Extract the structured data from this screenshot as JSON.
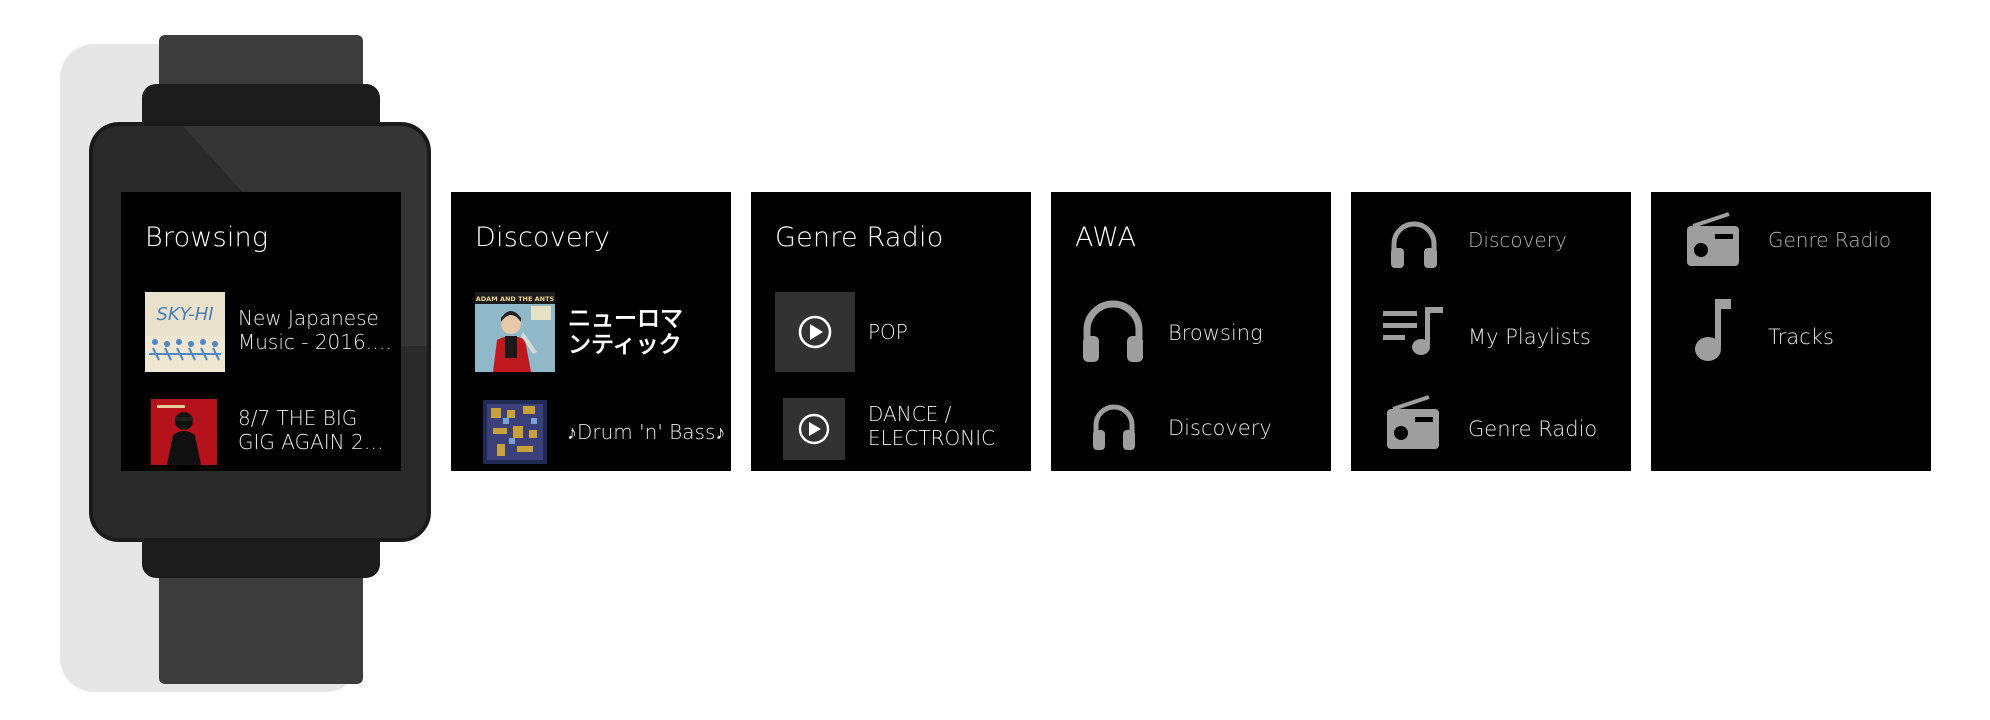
{
  "screens": {
    "browsing": {
      "title": "Browsing",
      "items": [
        {
          "line1": "New Japanese",
          "line2": "Music - 2016.0…",
          "art_text": "SKY-HI"
        },
        {
          "line1": "8/7 THE BIG",
          "line2": "GIG AGAIN 201…"
        }
      ]
    },
    "discovery": {
      "title": "Discovery",
      "items": [
        {
          "line1": "ニューロマ",
          "line2": "ンティック",
          "art_text": "ADAM AND THE ANTS"
        },
        {
          "line1": "♪Drum 'n' Bass♪"
        }
      ]
    },
    "genre_radio": {
      "title": "Genre Radio",
      "items": [
        {
          "label": "POP",
          "icon": "play-circle-icon"
        },
        {
          "line1": "DANCE /",
          "line2": "ELECTRONIC",
          "icon": "play-circle-icon"
        }
      ]
    },
    "awa_menu": {
      "title": "AWA",
      "items": [
        {
          "label": "Browsing",
          "icon": "headphones-icon"
        },
        {
          "label": "Discovery",
          "icon": "headphones-icon"
        }
      ]
    },
    "menu_mid": {
      "items": [
        {
          "label": "Discovery",
          "icon": "headphones-icon"
        },
        {
          "label": "My Playlists",
          "icon": "playlist-icon"
        },
        {
          "label": "Genre Radio",
          "icon": "radio-icon"
        }
      ]
    },
    "menu_end": {
      "items": [
        {
          "label": "Genre Radio",
          "icon": "radio-icon"
        },
        {
          "label": "Tracks",
          "icon": "music-note-icon"
        }
      ]
    }
  },
  "colors": {
    "screen_bg": "#000000",
    "watch_body": "#2a2a2a",
    "strap": "#3c3c3c",
    "icon_gray": "#9e9e9e",
    "tile_gray": "#323232"
  }
}
